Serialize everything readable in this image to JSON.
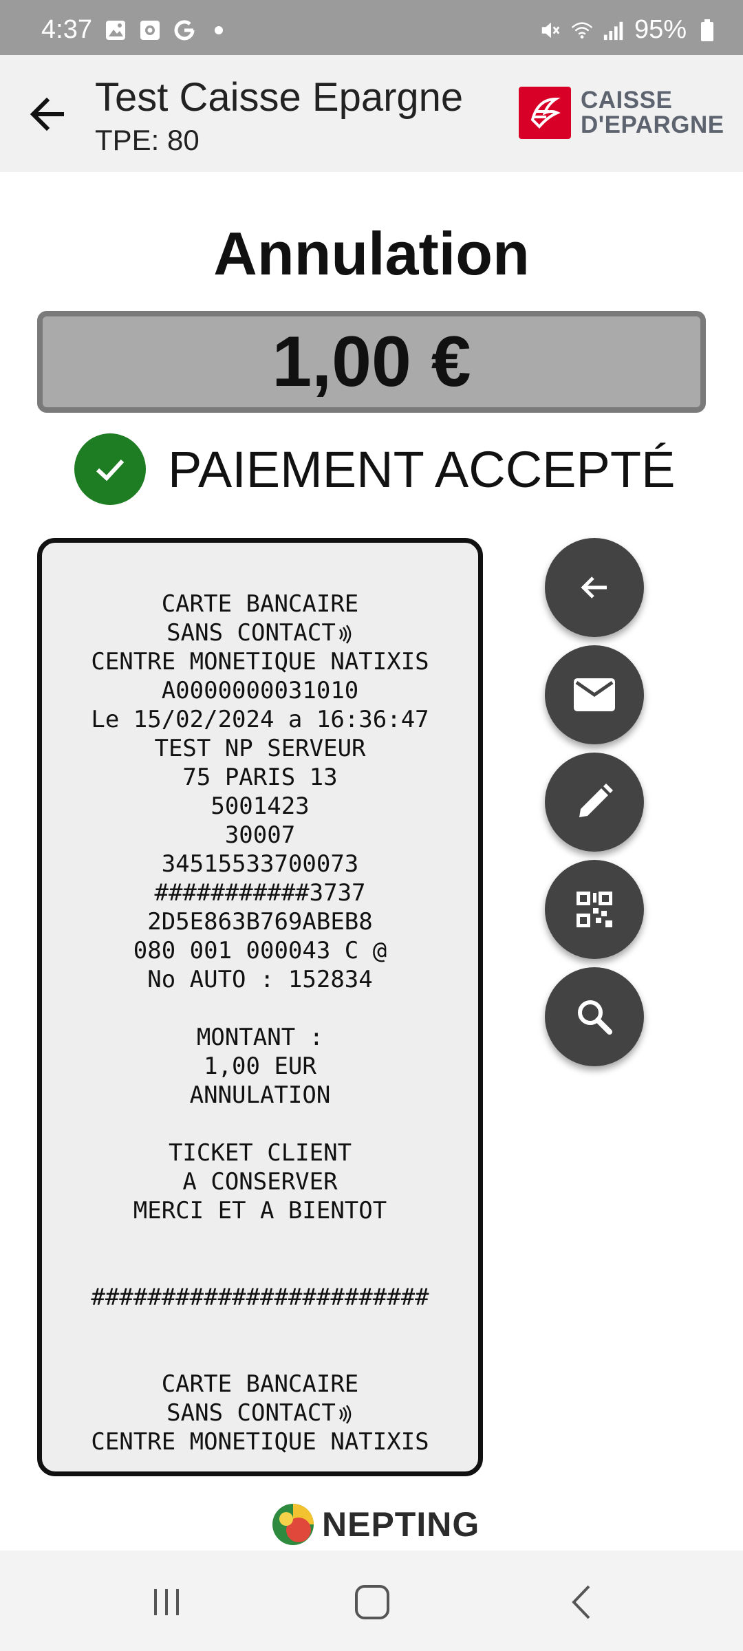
{
  "status_bar": {
    "time": "4:37",
    "battery": "95%",
    "icons_left": [
      "image-icon",
      "note-icon",
      "google-icon",
      "dot-icon"
    ],
    "icons_right": [
      "mute-icon",
      "wifi-icon",
      "signal-icon",
      "battery-icon"
    ]
  },
  "header": {
    "title": "Test Caisse Epargne",
    "subtitle": "TPE: 80",
    "brand_line1": "CAISSE",
    "brand_line2": "D'EPARGNE",
    "brand_color": "#d90028"
  },
  "transaction": {
    "type": "Annulation",
    "amount": "1,00 €",
    "status": "PAIEMENT ACCEPTÉ",
    "status_color": "#1e7d22"
  },
  "receipt": {
    "lines": [
      "CARTE BANCAIRE",
      "SANS CONTACT",
      "CENTRE MONETIQUE NATIXIS",
      "A0000000031010",
      "Le 15/02/2024 a 16:36:47",
      "TEST NP SERVEUR",
      "75 PARIS 13",
      "5001423",
      "30007",
      "34515533700073",
      "###########3737",
      "2D5E863B769ABEB8",
      "080 001 000043 C @",
      "No AUTO : 152834",
      "",
      "MONTANT :",
      "1,00 EUR",
      "ANNULATION",
      "",
      "TICKET CLIENT",
      "A CONSERVER",
      "MERCI ET A BIENTOT",
      "",
      "",
      "########################",
      "",
      "",
      "CARTE BANCAIRE",
      "SANS CONTACT",
      "CENTRE MONETIQUE NATIXIS"
    ]
  },
  "actions": [
    "back-action-icon",
    "email-icon",
    "edit-icon",
    "qr-code-icon",
    "search-icon"
  ],
  "footer": {
    "brand": "NEPTING"
  },
  "nav": [
    "recents-icon",
    "home-icon",
    "back-icon"
  ],
  "colors": {
    "fab": "#434343",
    "amount_box": "#aaaaaa",
    "receipt_bg": "#eeeeee"
  }
}
